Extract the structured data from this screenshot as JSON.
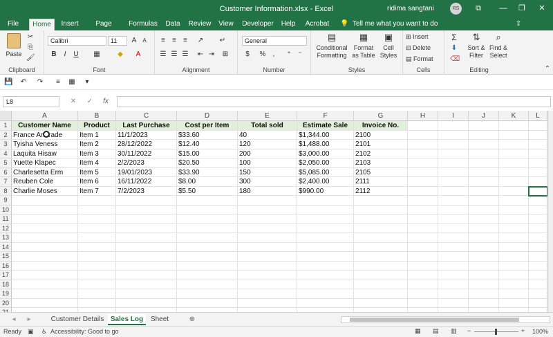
{
  "window": {
    "title": "Customer Information.xlsx  -  Excel",
    "user_name": "ridima sangtani",
    "user_initials": "RS"
  },
  "ribbon_tabs": [
    "File",
    "Home",
    "Insert",
    "Page Layout",
    "Formulas",
    "Data",
    "Review",
    "View",
    "Developer",
    "Help",
    "Acrobat"
  ],
  "active_tab": "Home",
  "tell_me": "Tell me what you want to do",
  "ribbon": {
    "clipboard": {
      "paste": "Paste",
      "label": "Clipboard"
    },
    "font": {
      "name": "Calibri",
      "size": "11",
      "bold": "B",
      "italic": "I",
      "underline": "U",
      "label": "Font"
    },
    "alignment": {
      "label": "Alignment"
    },
    "number": {
      "format": "General",
      "currency": "$",
      "percent": "%",
      "comma": ",",
      "label": "Number"
    },
    "styles": {
      "conditional": "Conditional Formatting",
      "format_as_table": "Format as Table",
      "cell_styles": "Cell Styles",
      "label": "Styles"
    },
    "cells": {
      "insert": "Insert",
      "delete": "Delete",
      "format": "Format",
      "label": "Cells"
    },
    "editing": {
      "sort_filter": "Sort & Filter",
      "find_select": "Find & Select",
      "label": "Editing"
    }
  },
  "formula_bar": {
    "name_box": "L8",
    "cancel": "✕",
    "enter": "✓",
    "fx": "fx",
    "formula": ""
  },
  "columns": [
    "A",
    "B",
    "C",
    "D",
    "E",
    "F",
    "G",
    "H",
    "I",
    "J",
    "K",
    "L"
  ],
  "rows": [
    "1",
    "2",
    "3",
    "4",
    "5",
    "6",
    "7",
    "8",
    "9",
    "10",
    "11",
    "12",
    "13",
    "14",
    "15",
    "16",
    "17",
    "18",
    "19",
    "20",
    "21"
  ],
  "headers": [
    "Customer Name",
    "Product",
    "Last Purchase",
    "Cost per Item",
    "Total sold",
    "Estimate Sale",
    "Invoice No."
  ],
  "data_rows": [
    [
      "France Andrade",
      "Item 1",
      "11/1/2023",
      "$33.60",
      "40",
      "$1,344.00",
      "2100"
    ],
    [
      "Tyisha Veness",
      "Item 2",
      "28/12/2022",
      "$12.40",
      "120",
      "$1,488.00",
      "2101"
    ],
    [
      "Laquita Hisaw",
      "Item 3",
      "30/11/2022",
      "$15.00",
      "200",
      "$3,000.00",
      "2102"
    ],
    [
      "Yuette Klapec",
      "Item 4",
      "2/2/2023",
      "$20.50",
      "100",
      "$2,050.00",
      "2103"
    ],
    [
      "Charlesetta Erm",
      "Item 5",
      "19/01/2023",
      "$33.90",
      "150",
      "$5,085.00",
      "2105"
    ],
    [
      "Reuben Cole",
      "Item 6",
      "16/11/2022",
      "$8.00",
      "300",
      "$2,400.00",
      "2111"
    ],
    [
      "Charlie Moses",
      "Item 7",
      "7/2/2023",
      "$5.50",
      "180",
      "$990.00",
      "2112"
    ]
  ],
  "sheets": [
    "Customer Details",
    "Sales Log",
    "Sheet"
  ],
  "active_sheet": "Sales Log",
  "status": {
    "ready": "Ready",
    "accessibility": "Accessibility: Good to go",
    "zoom": "100%"
  },
  "colors": {
    "brand": "#217346",
    "header_fill": "#e2efda"
  }
}
